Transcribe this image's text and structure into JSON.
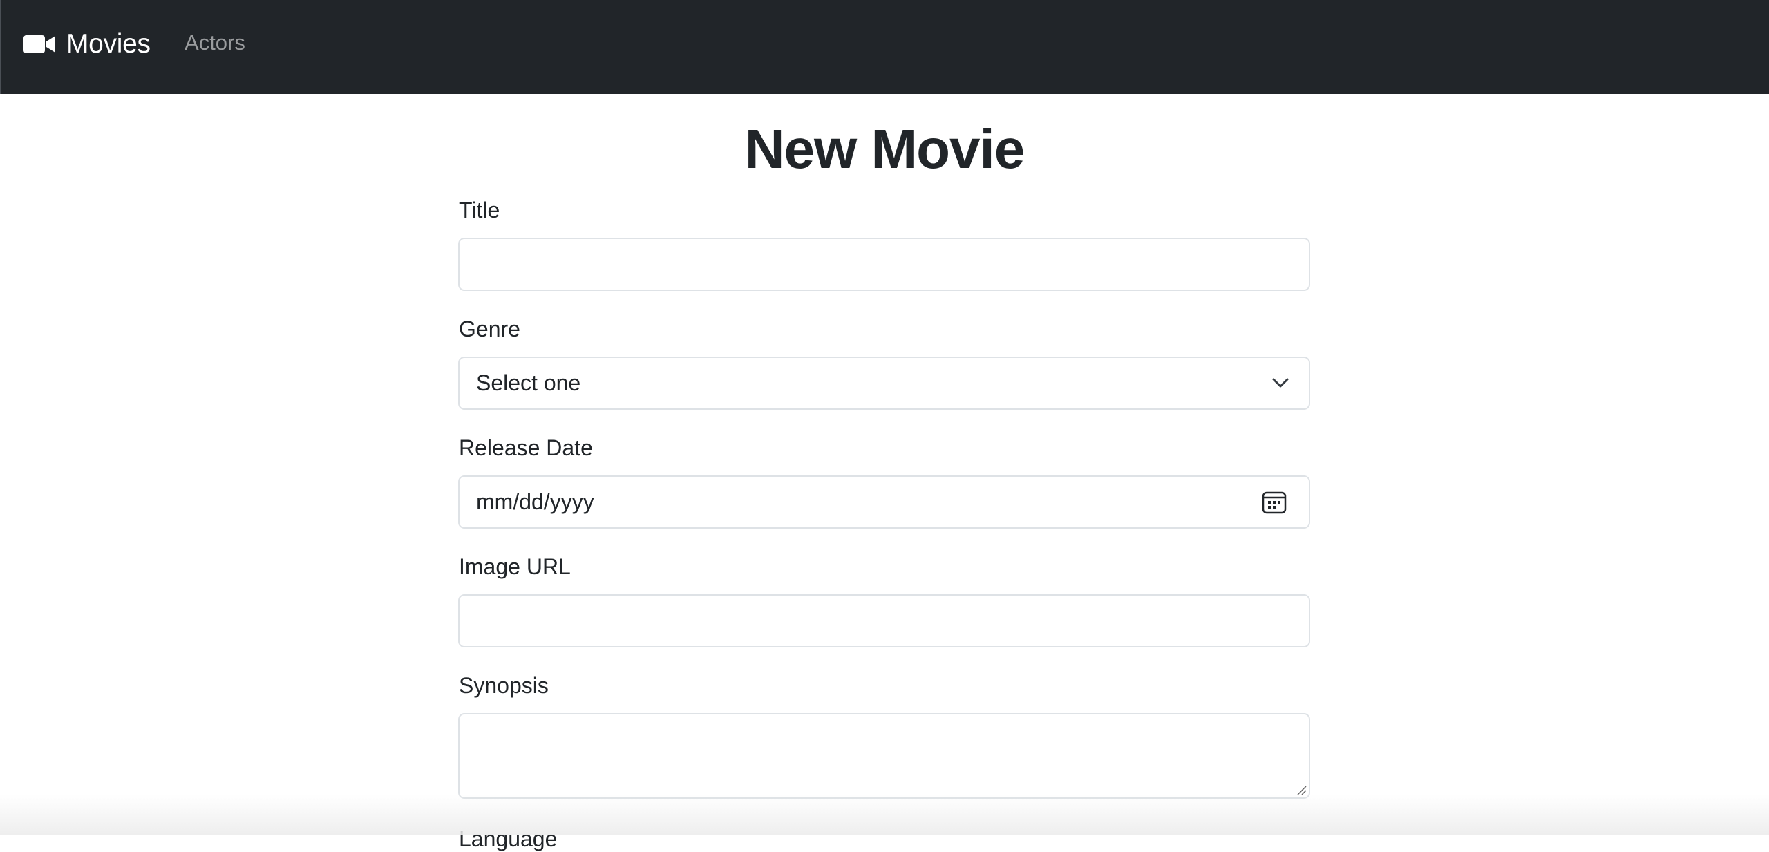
{
  "navbar": {
    "brand": {
      "label": "Movies",
      "icon": "video-camera-icon"
    },
    "links": [
      {
        "label": "Actors"
      }
    ]
  },
  "page": {
    "title": "New Movie"
  },
  "form": {
    "title": {
      "label": "Title",
      "value": ""
    },
    "genre": {
      "label": "Genre",
      "selected": "Select one"
    },
    "release": {
      "label": "Release Date",
      "placeholder": "mm/dd/yyyy",
      "icon": "calendar-icon"
    },
    "image": {
      "label": "Image URL",
      "value": ""
    },
    "synopsis": {
      "label": "Synopsis",
      "value": ""
    },
    "language": {
      "label": "Language"
    }
  },
  "colors": {
    "navbar_bg": "#212529",
    "nav_link": "#8c8f92",
    "border": "#dee2e6",
    "text": "#212529"
  }
}
